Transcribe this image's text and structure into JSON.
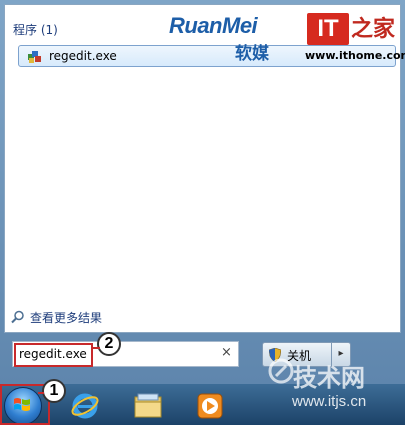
{
  "start_menu": {
    "section_title": "程序 (1)",
    "result_item": {
      "label": "regedit.exe",
      "icon": "registry-editor-icon"
    },
    "more_results_label": "查看更多结果",
    "search": {
      "value": "regedit.exe",
      "clear_glyph": "×"
    },
    "shutdown": {
      "label": "关机",
      "arrow_glyph": "▸"
    }
  },
  "taskbar": {
    "items": [
      {
        "name": "start-button",
        "icon": "windows-orb-icon"
      },
      {
        "name": "internet-explorer",
        "icon": "ie-icon"
      },
      {
        "name": "windows-explorer",
        "icon": "folder-icon"
      },
      {
        "name": "media-player",
        "icon": "media-player-icon"
      }
    ]
  },
  "annotations": {
    "step1": "1",
    "step2": "2"
  },
  "watermarks": {
    "ruanmei_latin": "RuanMei",
    "ruanmei_cn": "软媒",
    "it_logo": "IT",
    "ithome_cn": "之家",
    "ithome_url": "www.ithome.com",
    "itjs_cn": "技术网",
    "itjs_url": "www.itjs.cn"
  },
  "colors": {
    "accent_red": "#c8292b",
    "link_blue": "#1e3d7b",
    "brand_blue": "#1d5ea8"
  }
}
